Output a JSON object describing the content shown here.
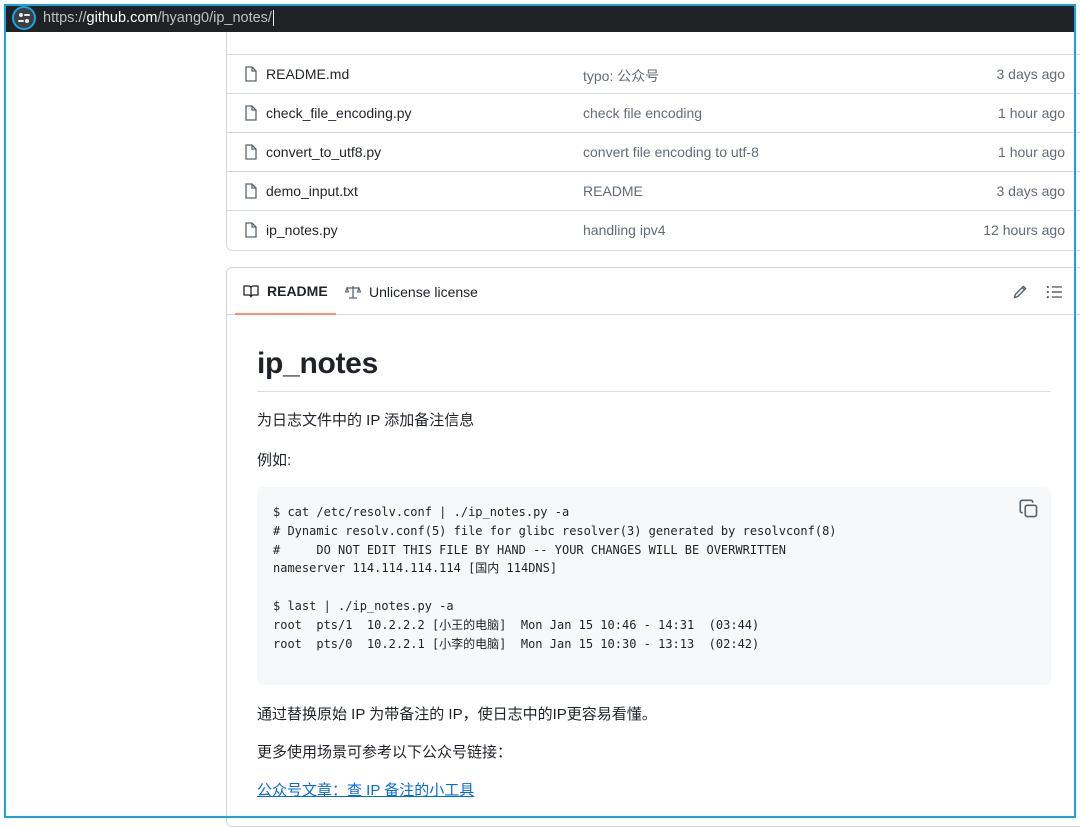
{
  "browser": {
    "url_scheme": "https://",
    "url_host": "github.com",
    "url_path": "/hyang0/ip_notes/"
  },
  "files": [
    {
      "name": "README.md",
      "message": "typo: 公众号",
      "time": "3 days ago"
    },
    {
      "name": "check_file_encoding.py",
      "message": "check file encoding",
      "time": "1 hour ago"
    },
    {
      "name": "convert_to_utf8.py",
      "message": "convert file encoding to utf-8",
      "time": "1 hour ago"
    },
    {
      "name": "demo_input.txt",
      "message": "README",
      "time": "3 days ago"
    },
    {
      "name": "ip_notes.py",
      "message": "handling ipv4",
      "time": "12 hours ago"
    }
  ],
  "readme": {
    "tabs": {
      "readme": "README",
      "license": "Unlicense license"
    },
    "title": "ip_notes",
    "description": "为日志文件中的 IP 添加备注信息",
    "example_label": "例如:",
    "code": "$ cat /etc/resolv.conf | ./ip_notes.py -a\n# Dynamic resolv.conf(5) file for glibc resolver(3) generated by resolvconf(8)\n#     DO NOT EDIT THIS FILE BY HAND -- YOUR CHANGES WILL BE OVERWRITTEN\nnameserver 114.114.114.114 [国内 114DNS]\n\n$ last | ./ip_notes.py -a\nroot  pts/1  10.2.2.2 [小王的电脑]  Mon Jan 15 10:46 - 14:31  (03:44)\nroot  pts/0  10.2.2.1 [小李的电脑]  Mon Jan 15 10:30 - 13:13  (02:42)",
    "explanation": "通过替换原始 IP 为带备注的 IP，使日志中的IP更容易看懂。",
    "more_info": "更多使用场景可参考以下公众号链接：",
    "link_text": "公众号文章：查 IP 备注的小工具"
  },
  "colors": {
    "accent_tab": "#fd8c73",
    "link": "#0969da",
    "frame": "#1aa3e0"
  }
}
